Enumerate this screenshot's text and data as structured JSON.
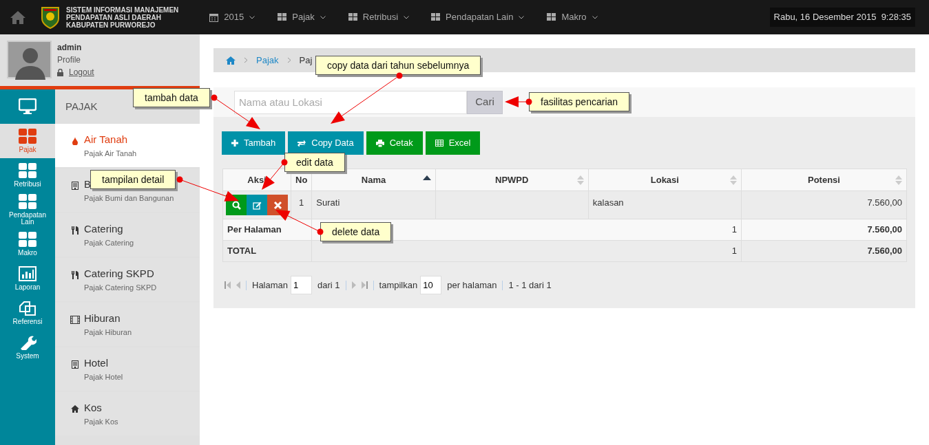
{
  "header": {
    "title_lines": [
      "SISTEM INFORMASI MANAJEMEN",
      "PENDAPATAN ASLI DAERAH",
      "KABUPATEN PURWOREJO"
    ],
    "menus": [
      {
        "label": "2015"
      },
      {
        "label": "Pajak"
      },
      {
        "label": "Retribusi"
      },
      {
        "label": "Pendapatan Lain"
      },
      {
        "label": "Makro"
      }
    ],
    "datetime": "Rabu, 16 Desember 2015  9:28:35"
  },
  "user": {
    "name": "admin",
    "profile": "Profile",
    "logout": "Logout"
  },
  "rail": [
    {
      "label": "Pajak",
      "selected": true
    },
    {
      "label": "Retribusi",
      "selected": false
    },
    {
      "label": "Pendapatan Lain",
      "selected": false
    },
    {
      "label": "Makro",
      "selected": false
    },
    {
      "label": "Laporan",
      "selected": false
    },
    {
      "label": "Referensi",
      "selected": false
    },
    {
      "label": "System",
      "selected": false
    }
  ],
  "submenu": {
    "heading": "PAJAK",
    "items": [
      {
        "title": "Air Tanah",
        "subtitle": "Pajak Air Tanah",
        "selected": true
      },
      {
        "title": "B",
        "subtitle": "Pajak Bumi dan Bangunan",
        "selected": false
      },
      {
        "title": "Catering",
        "subtitle": "Pajak Catering",
        "selected": false
      },
      {
        "title": "Catering SKPD",
        "subtitle": "Pajak Catering SKPD",
        "selected": false
      },
      {
        "title": "Hiburan",
        "subtitle": "Pajak Hiburan",
        "selected": false
      },
      {
        "title": "Hotel",
        "subtitle": "Pajak Hotel",
        "selected": false
      },
      {
        "title": "Kos",
        "subtitle": "Pajak Kos",
        "selected": false
      }
    ]
  },
  "breadcrumb": [
    "Pajak",
    "Paj"
  ],
  "search": {
    "placeholder": "Nama atau Lokasi",
    "button": "Cari"
  },
  "toolbar": [
    {
      "label": "Tambah",
      "color": "#0092a8"
    },
    {
      "label": "Copy Data",
      "color": "#0092a8"
    },
    {
      "label": "Cetak",
      "color": "#009a1a"
    },
    {
      "label": "Excel",
      "color": "#009a1a"
    }
  ],
  "table": {
    "columns": [
      {
        "label": "Aksi",
        "sortable": false
      },
      {
        "label": "No",
        "sortable": false
      },
      {
        "label": "Nama",
        "sorted_ascending": true
      },
      {
        "label": "NPWPD",
        "sortable": true,
        "sorted_ascending": false
      },
      {
        "label": "Lokasi",
        "sortable": true,
        "sorted_ascending": false
      },
      {
        "label": "Potensi",
        "sortable": true,
        "sorted_ascending": false
      }
    ],
    "rows": [
      {
        "no": "1",
        "nama": "Surati",
        "lokasi": "kalasan",
        "potensi": "7.560,00"
      }
    ],
    "summary": [
      {
        "label": "Per Halaman",
        "count": "1",
        "total": "7.560,00"
      },
      {
        "label": "TOTAL",
        "count": "1",
        "total": "7.560,00"
      }
    ]
  },
  "pager": {
    "page_label": "Halaman",
    "page": "1",
    "of": "dari 1",
    "show_label": "tampilkan",
    "per_page": "10",
    "per_page_label": "per halaman",
    "range": "1 - 1 dari 1"
  },
  "callouts": [
    {
      "text": "tambah data"
    },
    {
      "text": "copy data dari tahun sebelumnya"
    },
    {
      "text": "fasilitas pencarian"
    },
    {
      "text": "tampilan detail"
    },
    {
      "text": "edit data"
    },
    {
      "text": "delete data"
    }
  ]
}
